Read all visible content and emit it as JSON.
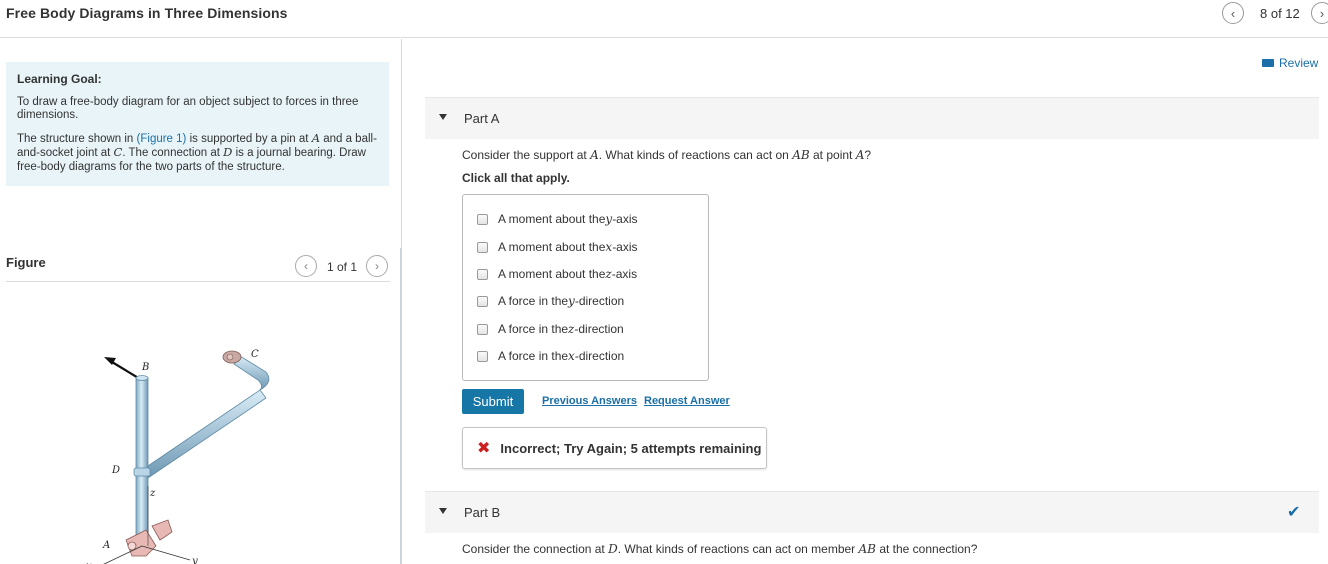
{
  "header": {
    "title": "Free Body Diagrams in Three Dimensions",
    "page_count": "8 of 12",
    "prev_icon": "chevron-left-icon",
    "next_icon": "chevron-right-icon"
  },
  "review": {
    "label": "Review",
    "icon": "book-icon"
  },
  "learning_goal": {
    "heading": "Learning Goal:",
    "goal_text": "To draw a free-body diagram for an object subject to forces in three dimensions.",
    "p2_a": "The structure shown in ",
    "figure_link": "(Figure 1)",
    "p2_b": " is supported by a pin at ",
    "var_A": "A",
    "p2_c": " and a ball-and-socket joint at ",
    "var_C": "C",
    "p2_d": ". The connection at ",
    "var_D": "D",
    "p2_e": " is a journal bearing. Draw free-body diagrams for the two parts of the structure."
  },
  "figure": {
    "heading": "Figure",
    "count": "1 of 1",
    "labels": {
      "B": "B",
      "C": "C",
      "D": "D",
      "A": "A",
      "z": "z",
      "x": "x",
      "y": "y"
    }
  },
  "part_a": {
    "label": "Part A",
    "question_a": "Consider the support at ",
    "question_var1": "A",
    "question_b": ". What kinds of reactions can act on ",
    "question_var2": "AB",
    "question_c": " at point ",
    "question_var3": "A",
    "question_d": "?",
    "instruction": "Click all that apply.",
    "options": [
      {
        "pre": "A moment about the ",
        "var": "y",
        "post": "-axis",
        "checked": false
      },
      {
        "pre": "A moment about the ",
        "var": "x",
        "post": "-axis",
        "checked": false
      },
      {
        "pre": "A moment about the ",
        "var": "z",
        "post": "-axis",
        "checked": false
      },
      {
        "pre": "A force in the ",
        "var": "y",
        "post": "-direction",
        "checked": false
      },
      {
        "pre": "A force in the ",
        "var": "z",
        "post": "-direction",
        "checked": false
      },
      {
        "pre": "A force in the ",
        "var": "x",
        "post": "-direction",
        "checked": false
      }
    ],
    "submit_label": "Submit",
    "previous_answers_label": "Previous Answers",
    "request_answer_label": "Request Answer",
    "feedback": "Incorrect; Try Again; 5 attempts remaining"
  },
  "part_b": {
    "label": "Part B",
    "question_a": "Consider the connection at ",
    "question_var1": "D",
    "question_b": ". What kinds of reactions can act on member ",
    "question_var2": "AB",
    "question_c": " at the connection?"
  },
  "colors": {
    "accent": "#1677a6",
    "goal_bg": "#e8f4f8",
    "error": "#cc1f1f"
  }
}
